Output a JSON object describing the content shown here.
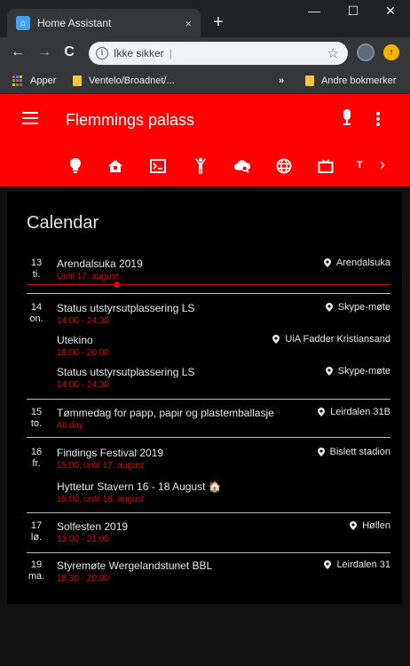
{
  "browser": {
    "tab_title": "Home Assistant",
    "tab_close": "×",
    "new_tab": "+",
    "window_controls": {
      "minimize": "—",
      "maximize": "☐",
      "close": "✕"
    },
    "nav": {
      "back": "←",
      "forward": "→",
      "reload": "C"
    },
    "address": {
      "info": "i",
      "security_text": "Ikke sikker",
      "separator": "|",
      "value": ""
    },
    "bookmark_star": "☆",
    "update_badge": "↑",
    "bookmarks": [
      {
        "label": "Apper",
        "type": "apps"
      },
      {
        "label": "Ventelo/Broadnet/...",
        "type": "folder"
      }
    ],
    "bookmarks_overflow": "»",
    "other_bookmarks": "Andre bokmerker"
  },
  "header": {
    "title": "Flemmings palass",
    "nav_icons": [
      "lightbulb-icon",
      "home-alert-icon",
      "console-icon",
      "human-icon",
      "cloud-search-icon",
      "web-icon",
      "tv-icon"
    ],
    "nav_text": "T",
    "nav_chevron": "›"
  },
  "calendar": {
    "title": "Calendar",
    "days": [
      {
        "date_num": "13",
        "date_day": "ti.",
        "events": [
          {
            "title": "Arendalsuka 2019",
            "time": "Until 17. august",
            "location": "Arendalsuka"
          }
        ]
      },
      {
        "date_num": "14",
        "date_day": "on.",
        "events": [
          {
            "title": "Status utstyrsutplassering LS",
            "time": "14:00 - 14:30",
            "location": "Skype-møte"
          },
          {
            "title": "Utekino",
            "time": "18:00 - 20:00",
            "location": "UiA Fadder Kristiansand"
          },
          {
            "title": "Status utstyrsutplassering LS",
            "time": "14:00 - 14:30",
            "location": "Skype-møte"
          }
        ]
      },
      {
        "date_num": "15",
        "date_day": "to.",
        "events": [
          {
            "title": "Tømmedag for papp, papir og plastemballasje",
            "time": "All day",
            "location": "Leirdalen 31B"
          }
        ]
      },
      {
        "date_num": "16",
        "date_day": "fr.",
        "events": [
          {
            "title": "Findings Festival 2019",
            "time": "15:00, until 17. august",
            "location": "Bislett stadion"
          },
          {
            "title": "Hyttetur Stavern 16 - 18 August 🏠",
            "time": "15:00, until 18. august",
            "location": ""
          }
        ]
      },
      {
        "date_num": "17",
        "date_day": "lø.",
        "events": [
          {
            "title": "Solfesten 2019",
            "time": "13:00 - 21:00",
            "location": "Høllen"
          }
        ]
      },
      {
        "date_num": "19",
        "date_day": "ma.",
        "events": [
          {
            "title": "Styremøte Wergelandstunet BBL",
            "time": "18:30 - 20:00",
            "location": "Leirdalen 31"
          }
        ]
      }
    ]
  },
  "colors": {
    "header_bg": "#ff0000",
    "accent_red": "#e00000",
    "card_bg": "#000000",
    "page_bg": "#111111",
    "text": "#e6e6e6"
  }
}
